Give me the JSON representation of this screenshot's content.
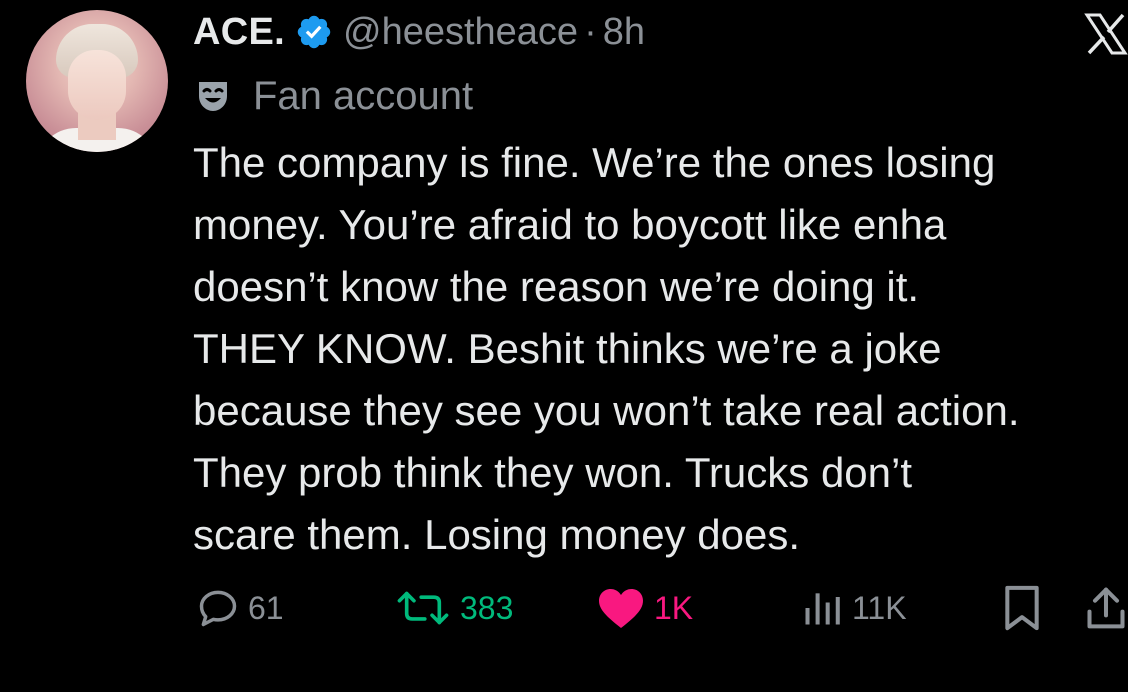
{
  "author": {
    "display_name": "ACE.",
    "verified": true,
    "handle": "@heestheace",
    "separator": "·",
    "time": "8h",
    "badge_icon": "theater-mask-icon",
    "badge_label": "Fan account"
  },
  "tweet": {
    "lines": [
      "The company is fine. We’re the ones losing",
      "money. You’re afraid to boycott like enha",
      "doesn’t know the reason we’re doing it.",
      "THEY KNOW. Beshit thinks we’re a joke",
      "because they see you won’t take real action.",
      "They prob think they won. Trucks don’t",
      "scare them. Losing money does."
    ]
  },
  "actions": {
    "replies": "61",
    "reposts": "383",
    "likes": "1K",
    "views": "11K"
  },
  "colors": {
    "background": "#000000",
    "text": "#e7e9ea",
    "secondary": "#8b9096",
    "verified": "#1d9bf0",
    "repost": "#00ba7c",
    "like": "#f91880"
  },
  "icons": [
    "verified-badge-icon",
    "x-logo-icon",
    "theater-mask-icon",
    "reply-icon",
    "repost-icon",
    "heart-icon",
    "views-icon",
    "bookmark-icon",
    "share-icon"
  ]
}
